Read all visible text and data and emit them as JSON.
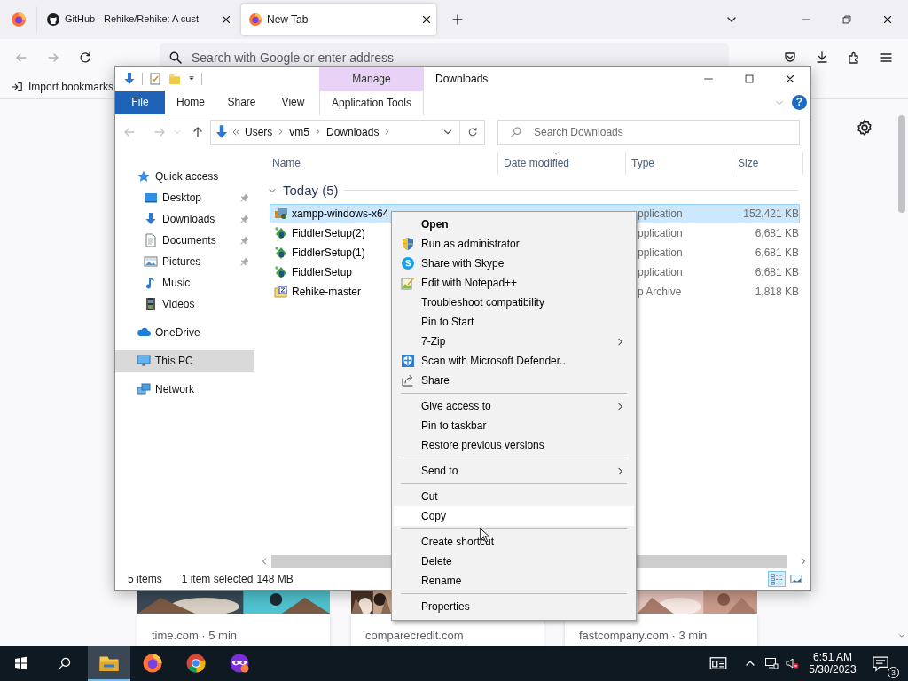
{
  "browser": {
    "tabs": [
      {
        "kind": "github",
        "title": "GitHub - Rehike/Rehike: A cust",
        "selected": false
      },
      {
        "kind": "firefox",
        "title": "New Tab",
        "selected": true
      }
    ],
    "nav_buttons": [
      {
        "kind": "back",
        "disabled": true
      },
      {
        "kind": "forward",
        "disabled": true
      },
      {
        "kind": "reload",
        "disabled": false
      }
    ],
    "address": {
      "placeholder": "Search with Google or enter address"
    },
    "bookmarks": [
      {
        "label": "Import bookmarks"
      }
    ],
    "cards": [
      {
        "source": "time.com · 5 min"
      },
      {
        "source": "comparecredit.com"
      },
      {
        "source": "fastcompany.com · 3 min"
      }
    ]
  },
  "explorer": {
    "title": "Downloads",
    "context_tab": "Manage",
    "ribbon_tabs": [
      {
        "label": "File",
        "kind": "file"
      },
      {
        "label": "Home",
        "kind": "tab"
      },
      {
        "label": "Share",
        "kind": "tab"
      },
      {
        "label": "View",
        "kind": "tab"
      },
      {
        "label": "Application Tools",
        "kind": "contextual"
      }
    ],
    "help": "?",
    "nav_buttons": [
      {
        "kind": "back",
        "disabled": true
      },
      {
        "kind": "forward",
        "disabled": true
      },
      {
        "kind": "recent",
        "disabled": true
      },
      {
        "kind": "up",
        "disabled": false
      }
    ],
    "address": {
      "path": [
        "Users",
        "vm5",
        "Downloads"
      ]
    },
    "search": {
      "placeholder": "Search Downloads"
    },
    "sidebar": [
      {
        "label": "Quick access",
        "selected": false,
        "children": [
          {
            "label": "Desktop",
            "pinned": true,
            "selected": false
          },
          {
            "label": "Downloads",
            "pinned": true,
            "selected": false
          },
          {
            "label": "Documents",
            "pinned": true,
            "selected": false
          },
          {
            "label": "Pictures",
            "pinned": true,
            "selected": false
          },
          {
            "label": "Music",
            "pinned": false,
            "selected": false
          },
          {
            "label": "Videos",
            "pinned": false,
            "selected": false
          }
        ]
      },
      {
        "label": "OneDrive",
        "selected": false
      },
      {
        "label": "This PC",
        "selected": true
      },
      {
        "label": "Network",
        "selected": false
      }
    ],
    "columns": [
      {
        "label": "Name",
        "sorted": false
      },
      {
        "label": "Date modified",
        "sorted": true
      },
      {
        "label": "Type",
        "sorted": false
      },
      {
        "label": "Size",
        "sorted": false
      }
    ],
    "group": {
      "label": "Today (5)",
      "expanded": true
    },
    "files": [
      {
        "name": "xampp-windows-x64",
        "type": "pplication",
        "size": "152,421 KB",
        "selected": true
      },
      {
        "name": "FiddlerSetup(2)",
        "type": "pplication",
        "size": "6,681 KB",
        "selected": false
      },
      {
        "name": "FiddlerSetup(1)",
        "type": "pplication",
        "size": "6,681 KB",
        "selected": false
      },
      {
        "name": "FiddlerSetup",
        "type": "pplication",
        "size": "6,681 KB",
        "selected": false
      },
      {
        "name": "Rehike-master",
        "type": "p Archive",
        "size": "1,818 KB",
        "selected": false
      }
    ],
    "status": {
      "items": "5 items",
      "selection": "1 item selected",
      "selection_size": "148 MB"
    },
    "views": [
      {
        "kind": "details",
        "selected": true
      },
      {
        "kind": "tiles",
        "selected": false
      }
    ]
  },
  "context_menu": {
    "items": [
      {
        "kind": "item",
        "label": "Open",
        "default": true,
        "submenu": false,
        "selected": false
      },
      {
        "kind": "item",
        "label": "Run as administrator",
        "default": false,
        "submenu": false,
        "selected": false
      },
      {
        "kind": "item",
        "label": "Share with Skype",
        "default": false,
        "submenu": false,
        "selected": false
      },
      {
        "kind": "item",
        "label": "Edit with Notepad++",
        "default": false,
        "submenu": false,
        "selected": false
      },
      {
        "kind": "item",
        "label": "Troubleshoot compatibility",
        "default": false,
        "submenu": false,
        "selected": false
      },
      {
        "kind": "item",
        "label": "Pin to Start",
        "default": false,
        "submenu": false,
        "selected": false
      },
      {
        "kind": "item",
        "label": "7-Zip",
        "default": false,
        "submenu": true,
        "selected": false
      },
      {
        "kind": "item",
        "label": "Scan with Microsoft Defender...",
        "default": false,
        "submenu": false,
        "selected": false
      },
      {
        "kind": "item",
        "label": "Share",
        "default": false,
        "submenu": false,
        "selected": false
      },
      {
        "kind": "separator"
      },
      {
        "kind": "item",
        "label": "Give access to",
        "default": false,
        "submenu": true,
        "selected": false
      },
      {
        "kind": "item",
        "label": "Pin to taskbar",
        "default": false,
        "submenu": false,
        "selected": false
      },
      {
        "kind": "item",
        "label": "Restore previous versions",
        "default": false,
        "submenu": false,
        "selected": false
      },
      {
        "kind": "separator"
      },
      {
        "kind": "item",
        "label": "Send to",
        "default": false,
        "submenu": true,
        "selected": false
      },
      {
        "kind": "separator"
      },
      {
        "kind": "item",
        "label": "Cut",
        "default": false,
        "submenu": false,
        "selected": false
      },
      {
        "kind": "item",
        "label": "Copy",
        "default": false,
        "submenu": false,
        "selected": true
      },
      {
        "kind": "separator"
      },
      {
        "kind": "item",
        "label": "Create shortcut",
        "default": false,
        "submenu": false,
        "selected": false
      },
      {
        "kind": "item",
        "label": "Delete",
        "default": false,
        "submenu": false,
        "selected": false
      },
      {
        "kind": "item",
        "label": "Rename",
        "default": false,
        "submenu": false,
        "selected": false
      },
      {
        "kind": "separator"
      },
      {
        "kind": "item",
        "label": "Properties",
        "default": false,
        "submenu": false,
        "selected": false
      }
    ]
  },
  "taskbar": {
    "apps": [
      {
        "kind": "explorer",
        "selected": true
      },
      {
        "kind": "firefox",
        "selected": false
      },
      {
        "kind": "chrome",
        "selected": false
      },
      {
        "kind": "mask",
        "selected": false
      }
    ],
    "volume_muted": true,
    "time": "6:51 AM",
    "date": "5/30/2023",
    "notifications": "3"
  }
}
